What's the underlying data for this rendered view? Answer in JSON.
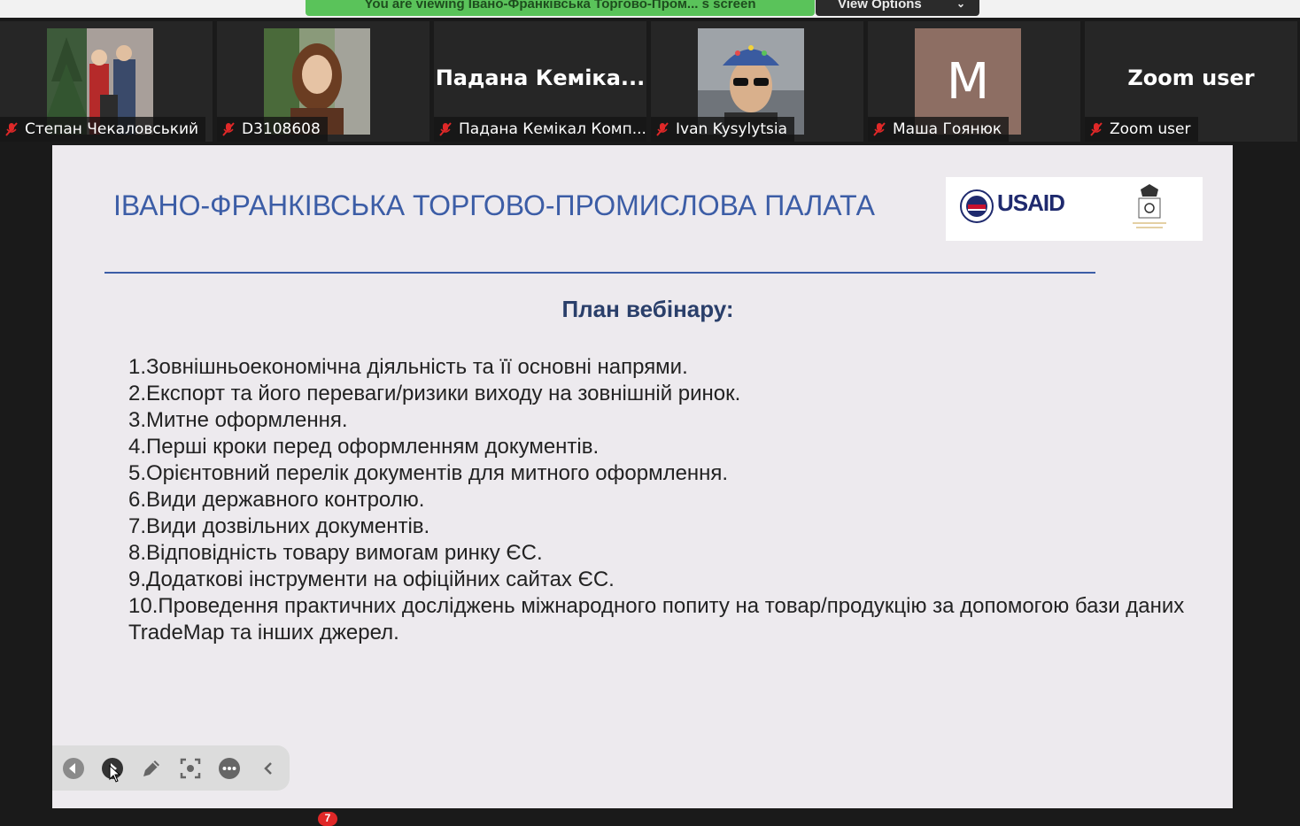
{
  "share_banner": {
    "text": "You are viewing Івано-Франківська Торгово-Пром... s screen"
  },
  "view_options": {
    "label": "View Options"
  },
  "participants": [
    {
      "name": "Степан Чекаловський",
      "video": "photo"
    },
    {
      "name": "D3108608",
      "video": "photo"
    },
    {
      "name": "Падана Кемікал Комп...",
      "display_name": "Падана  Кеміка...",
      "video": "name"
    },
    {
      "name": "Ivan Kysylytsia",
      "video": "photo"
    },
    {
      "name": "Маша Гоянюк",
      "initial": "M",
      "video": "initial"
    },
    {
      "name": "Zoom user",
      "display_name": "Zoom user",
      "video": "name"
    }
  ],
  "slide": {
    "title": "ІВАНО-ФРАНКІВСЬКА ТОРГОВО-ПРОМИСЛОВА ПАЛАТА",
    "logo_usaid": "USAID",
    "plan_title": "План вебінару:",
    "agenda": [
      "1.Зовнішньоекономічна діяльність та її основні напрями.",
      "2.Експорт та його переваги/ризики виходу на зовнішній ринок.",
      "3.Митне оформлення.",
      "4.Перші кроки перед оформленням документів.",
      "5.Орієнтовний перелік документів для митного оформлення.",
      "6.Види державного контролю.",
      "7.Види дозвільних документів.",
      "8.Відповідність товару вимогам ринку ЄС.",
      "9.Додаткові інструменти на офіційних сайтах ЄС.",
      "10.Проведення практичних досліджень міжнародного попиту на товар/продукцію за допомогою бази даних TradeMap та інших джерел."
    ]
  },
  "annotation_toolbar": [
    "previous-icon",
    "next-icon",
    "pen-icon",
    "spotlight-icon",
    "more-icon",
    "collapse-icon"
  ],
  "bottom_bar": {
    "chat_badge": "7"
  },
  "colors": {
    "banner": "#5ac35a",
    "title": "#3c5da6",
    "slide_bg": "#edeaee",
    "mic_muted": "#e02828"
  }
}
